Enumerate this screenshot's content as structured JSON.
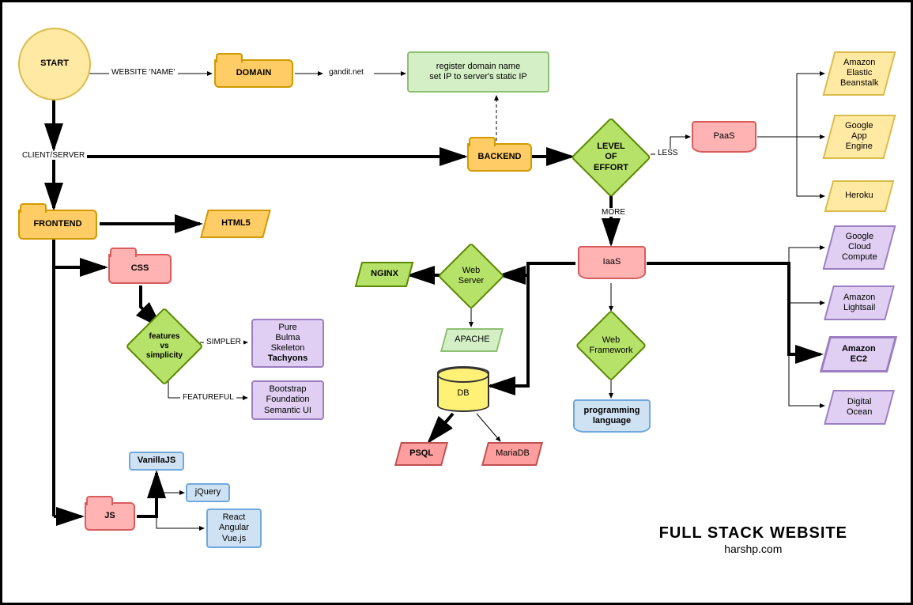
{
  "title": {
    "main": "FULL STACK WEBSITE",
    "sub": "harshp.com"
  },
  "nodes": {
    "start": "START",
    "domain": "DOMAIN",
    "gandit": "gandit.net",
    "register": "register domain name\nset IP to server's static IP",
    "backend": "BACKEND",
    "level": "LEVEL\nOF\nEFFORT",
    "paas": "PaaS",
    "beanstalk": "Amazon\nElastic\nBeanstalk",
    "gae": "Google\nApp\nEngine",
    "heroku": "Heroku",
    "frontend": "FRONTEND",
    "html5": "HTML5",
    "css": "CSS",
    "featvs": "features\nvs\nsimplicity",
    "simpler_list": "Pure\nBulma\nSkeleton\nTachyons",
    "featureful_list": "Bootstrap\nFoundation\nSemantic UI",
    "js": "JS",
    "vanilla": "VanillaJS",
    "jquery": "jQuery",
    "jsfw": "React\nAngular\nVue.js",
    "iaas": "IaaS",
    "webserver": "Web\nServer",
    "nginx": "NGINX",
    "apache": "APACHE",
    "db": "DB",
    "psql": "PSQL",
    "mariadb": "MariaDB",
    "webfw": "Web\nFramework",
    "proglang": "programming\nlanguage",
    "gcc": "Google\nCloud\nCompute",
    "lightsail": "Amazon\nLightsail",
    "ec2": "Amazon\nEC2",
    "docean": "Digital\nOcean"
  },
  "edge_labels": {
    "website_name": "WEBSITE 'NAME'",
    "client_server": "CLIENT/SERVER",
    "less": "LESS",
    "more": "MORE",
    "simpler": "SIMPLER",
    "featureful": "FEATUREFUL"
  }
}
